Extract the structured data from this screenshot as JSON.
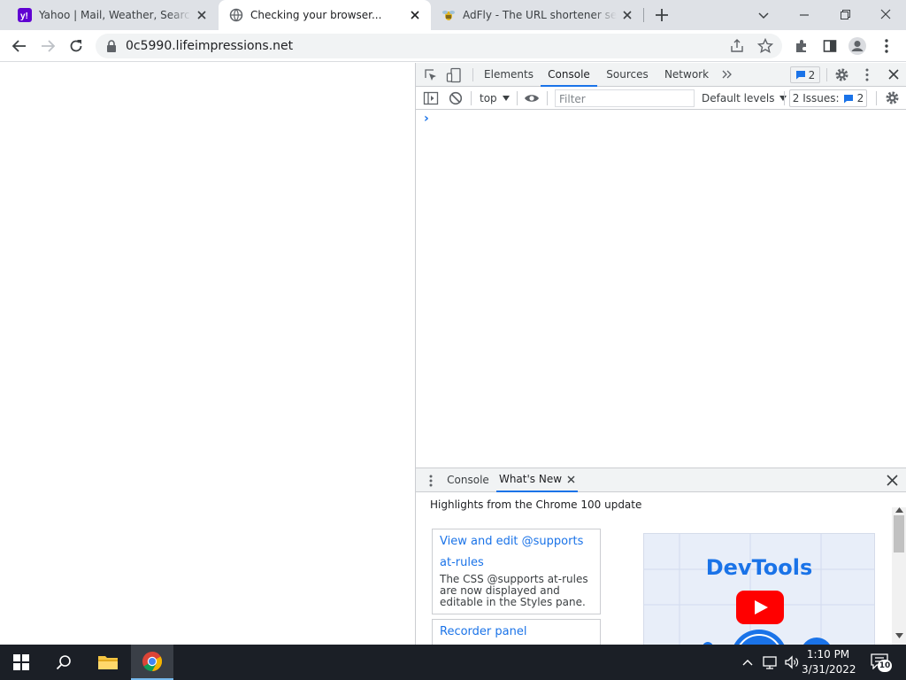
{
  "tabs": [
    {
      "title": "Yahoo | Mail, Weather, Search, Politics, News",
      "icon": "yahoo-favicon"
    },
    {
      "title": "Checking your browser...",
      "icon": "globe-favicon"
    },
    {
      "title": "AdFly - The URL shortener service",
      "icon": "adfly-favicon"
    }
  ],
  "toolbar": {
    "url": "0c5990.lifeimpressions.net"
  },
  "devtools": {
    "tabs": [
      "Elements",
      "Console",
      "Sources",
      "Network"
    ],
    "issues_badge": "2",
    "context": "top",
    "filter_placeholder": "Filter",
    "levels": "Default levels",
    "issues_label": "2 Issues:",
    "issues_count": "2",
    "prompt": "›"
  },
  "drawer": {
    "tabs": [
      "Console",
      "What's New"
    ],
    "highlights": "Highlights from the Chrome 100 update",
    "cards": [
      {
        "title_line1": "View and edit @supports",
        "title_line2": "at-rules",
        "desc_lines": [
          "The CSS @supports at-rules",
          "are now displayed and",
          "editable in the Styles pane."
        ]
      },
      {
        "title_line1": "Recorder panel"
      }
    ],
    "thumbnail_text": "DevTools"
  },
  "taskbar": {
    "time": "1:10 PM",
    "date": "3/31/2022",
    "notifications": "10"
  },
  "colors": {
    "accent": "#1a73e8",
    "taskbar": "#1b1f26",
    "tabstrip": "#dee1e6"
  }
}
